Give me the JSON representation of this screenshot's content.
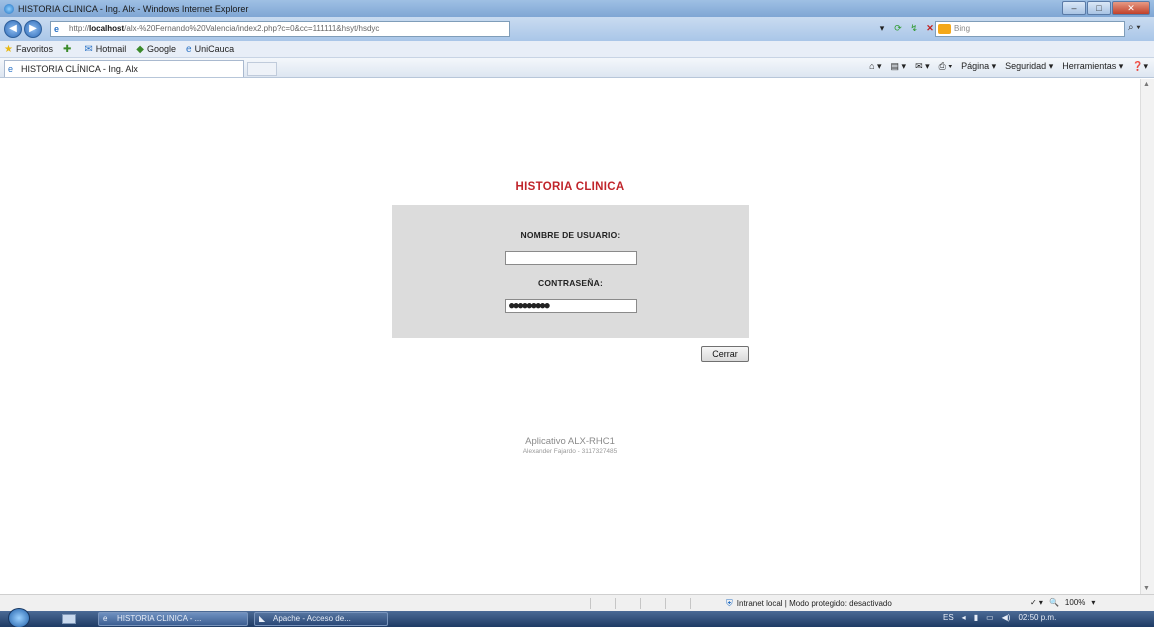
{
  "window": {
    "title": "HISTORIA CLINICA - Ing. Alx - Windows Internet Explorer",
    "buttons": [
      "",
      "",
      ""
    ]
  },
  "addressbar": {
    "url_prefix": "http://",
    "url_host": "localhost",
    "url_rest": "/alx-%20Fernando%20Valencia/index2.php?c=0&cc=111111&hsyt/hsdyc",
    "search_placeholder": "Bing"
  },
  "favorites": {
    "label": "Favoritos",
    "items": [
      "Hotmail",
      "Google",
      "UniCauca"
    ]
  },
  "tab": {
    "label": "HISTORIA CLÍNICA - Ing. Alx"
  },
  "commandbar": {
    "items": [
      "Página ▾",
      "Seguridad ▾",
      "Herramientas ▾"
    ]
  },
  "page": {
    "title": "HISTORIA CLINICA",
    "username_label": "NOMBRE DE USUARIO:",
    "username_value": "",
    "password_label": "CONTRASEÑA:",
    "password_value": "●●●●●●●●●",
    "close_button": "Cerrar",
    "footer_app": "Aplicativo ALX-RHC1",
    "footer_author": "Alexander Fajardo - 3117327485"
  },
  "statusbar": {
    "zone": "Intranet local | Modo protegido: desactivado",
    "zoom": "100%"
  },
  "taskbar": {
    "items": [
      "HISTORIA CLINICA - ...",
      "Apache - Acceso de..."
    ],
    "clock": "02:50 p.m."
  },
  "colors": {
    "title_red": "#c0252b",
    "login_panel": "#dcdcdc"
  },
  "icons": [
    "ie-icon",
    "back-icon",
    "forward-icon",
    "refresh-icon",
    "stop-icon",
    "bing-icon",
    "search-icon",
    "favorites-star-icon",
    "home-icon",
    "print-icon",
    "help-icon",
    "intranet-icon",
    "start-orb-icon"
  ]
}
